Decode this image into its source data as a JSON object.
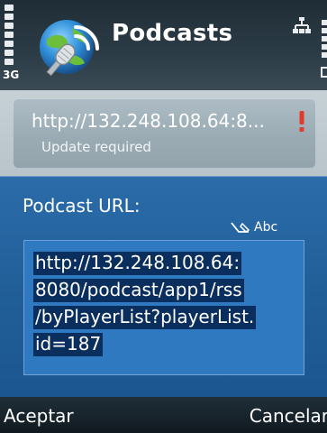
{
  "status_bar": {
    "network_label": "3G",
    "app_title": "Podcasts",
    "app_icon": "podcast-globe-icon",
    "connectivity_icon": "packet-data-icon"
  },
  "podcast_list": {
    "items": [
      {
        "url": "http://132.248.108.64:8...",
        "status": "Update required",
        "alert_icon": "exclamation-icon"
      }
    ]
  },
  "dialog": {
    "label": "Podcast URL:",
    "input_mode": "Abc",
    "url_lines": [
      "http://132.248.108.64:",
      "8080/podcast/app1/rss",
      "/byPlayerList?playerList.",
      "id=187"
    ]
  },
  "softkeys": {
    "left": "Aceptar",
    "right": "Cancelar"
  },
  "colors": {
    "dialog_bg": "#215f99",
    "selection": "#0a2e5d",
    "alert": "#e23b2e"
  }
}
